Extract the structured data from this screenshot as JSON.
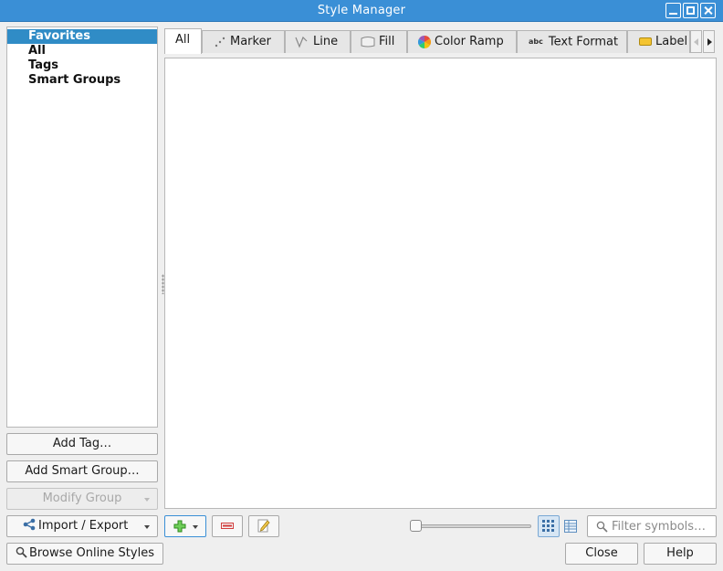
{
  "window": {
    "title": "Style Manager"
  },
  "groups": {
    "items": [
      {
        "label": "Favorites",
        "selected": true
      },
      {
        "label": "All"
      },
      {
        "label": "Tags"
      },
      {
        "label": "Smart Groups"
      }
    ]
  },
  "left_buttons": {
    "add_tag": "Add Tag…",
    "add_smart_group": "Add Smart Group…",
    "modify_group": "Modify Group",
    "import_export": "Import / Export",
    "browse_online": "Browse Online Styles"
  },
  "tabs": [
    {
      "label": "All",
      "icon": "none",
      "active": true
    },
    {
      "label": "Marker",
      "icon": "marker-icon"
    },
    {
      "label": "Line",
      "icon": "line-icon"
    },
    {
      "label": "Fill",
      "icon": "fill-icon"
    },
    {
      "label": "Color Ramp",
      "icon": "color-ramp-icon"
    },
    {
      "label": "Text Format",
      "icon": "text-format-icon"
    },
    {
      "label": "Label",
      "icon": "label-icon"
    }
  ],
  "filter": {
    "placeholder": "Filter symbols…",
    "value": ""
  },
  "dialog_buttons": {
    "close": "Close",
    "help": "Help"
  },
  "colors": {
    "accent": "#308cc6",
    "titlebar": "#3a8fd6"
  }
}
